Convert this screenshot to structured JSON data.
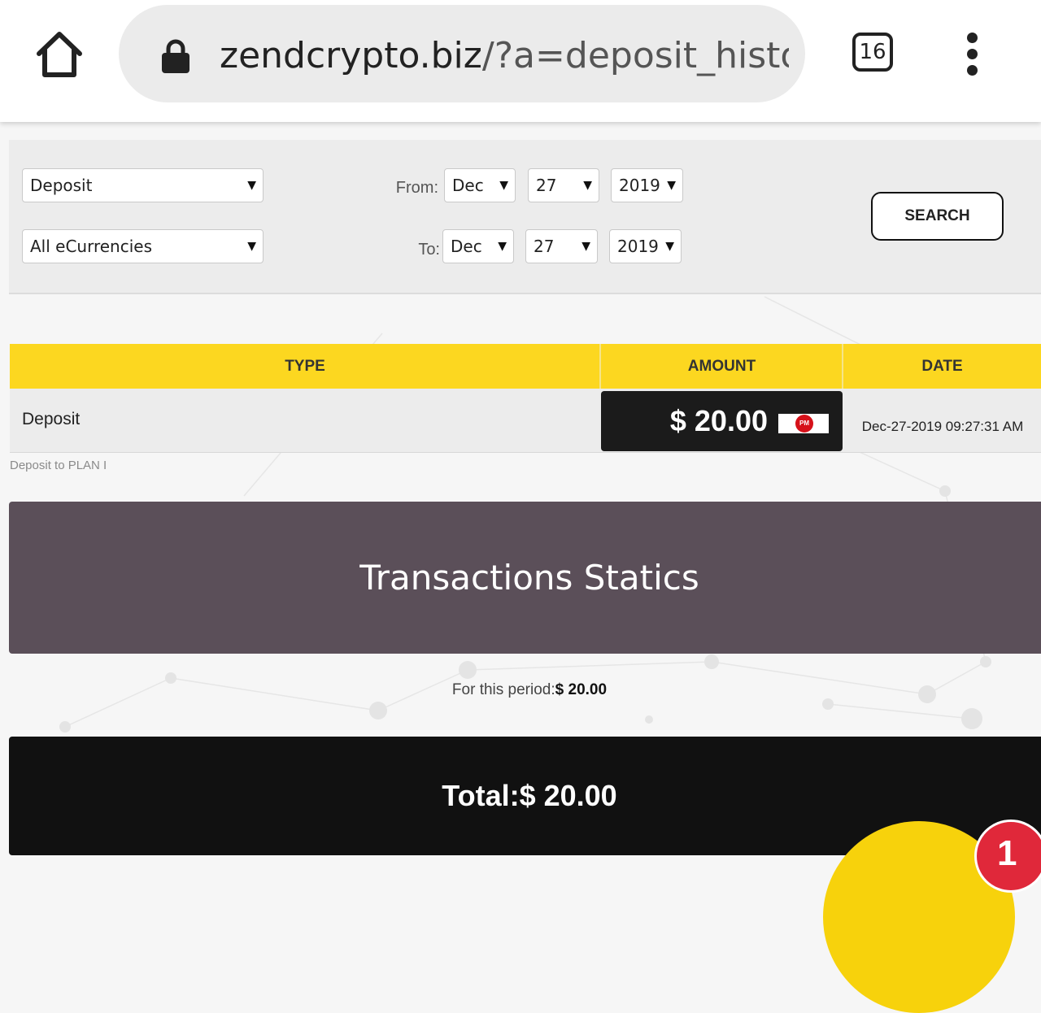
{
  "browser": {
    "url_host": "zendcrypto.biz",
    "url_path": "/?a=deposit_histor",
    "tab_count": "16"
  },
  "filters": {
    "type_select": "Deposit",
    "currency_select": "All eCurrencies",
    "from_label": "From:",
    "from_month": "Dec",
    "from_day": "27",
    "from_year": "2019",
    "to_label": "To:",
    "to_month": "Dec",
    "to_day": "27",
    "to_year": "2019",
    "search_label": "SEARCH"
  },
  "table": {
    "headers": {
      "type": "TYPE",
      "amount": "AMOUNT",
      "date": "DATE"
    },
    "rows": [
      {
        "type": "Deposit",
        "amount": "$ 20.00",
        "payment_badge": "PM",
        "date": "Dec-27-2019 09:27:31 AM",
        "note": "Deposit to PLAN I"
      }
    ]
  },
  "stats": {
    "title": "Transactions Statics",
    "period_label": "For this period:",
    "period_value": "$ 20.00",
    "total": "Total:$ 20.00"
  },
  "chat": {
    "badge_count": "1"
  },
  "colors": {
    "header_yellow": "#fcd720",
    "stats_bg": "#5b4f59",
    "total_bg": "#111111",
    "chat_yellow": "#f7d20c",
    "badge_red": "#e0283a"
  },
  "icons": {
    "home": "home-icon",
    "lock": "lock-icon",
    "menu": "more-vert-icon",
    "payment": "perfect-money-icon"
  }
}
